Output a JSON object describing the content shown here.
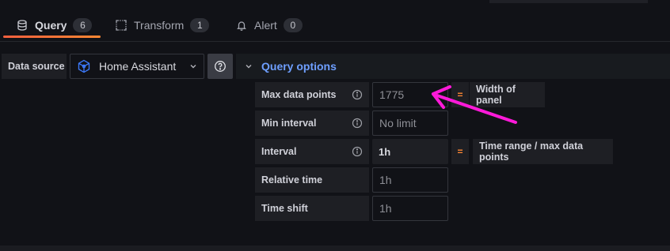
{
  "tabs": [
    {
      "label": "Query",
      "count": "6",
      "icon": "database-icon",
      "active": true
    },
    {
      "label": "Transform",
      "count": "1",
      "icon": "transform-icon",
      "active": false
    },
    {
      "label": "Alert",
      "count": "0",
      "icon": "bell-icon",
      "active": false
    }
  ],
  "datasource": {
    "label": "Data source",
    "selected": "Home Assistant",
    "help_icon": "question-circle-icon"
  },
  "query_options": {
    "title": "Query options",
    "rows": [
      {
        "label": "Max data points",
        "value": "1775",
        "result": "Width of panel"
      },
      {
        "label": "Min interval",
        "value": "No limit"
      },
      {
        "label": "Interval",
        "value": "1h",
        "result": "Time range / max data points"
      },
      {
        "label": "Relative time",
        "value": "1h"
      },
      {
        "label": "Time shift",
        "value": "1h"
      }
    ],
    "equals": "="
  },
  "colors": {
    "accent_blue": "#6e9fff",
    "accent_orange": "#ff8833",
    "annotation_magenta": "#ff1ad9"
  }
}
